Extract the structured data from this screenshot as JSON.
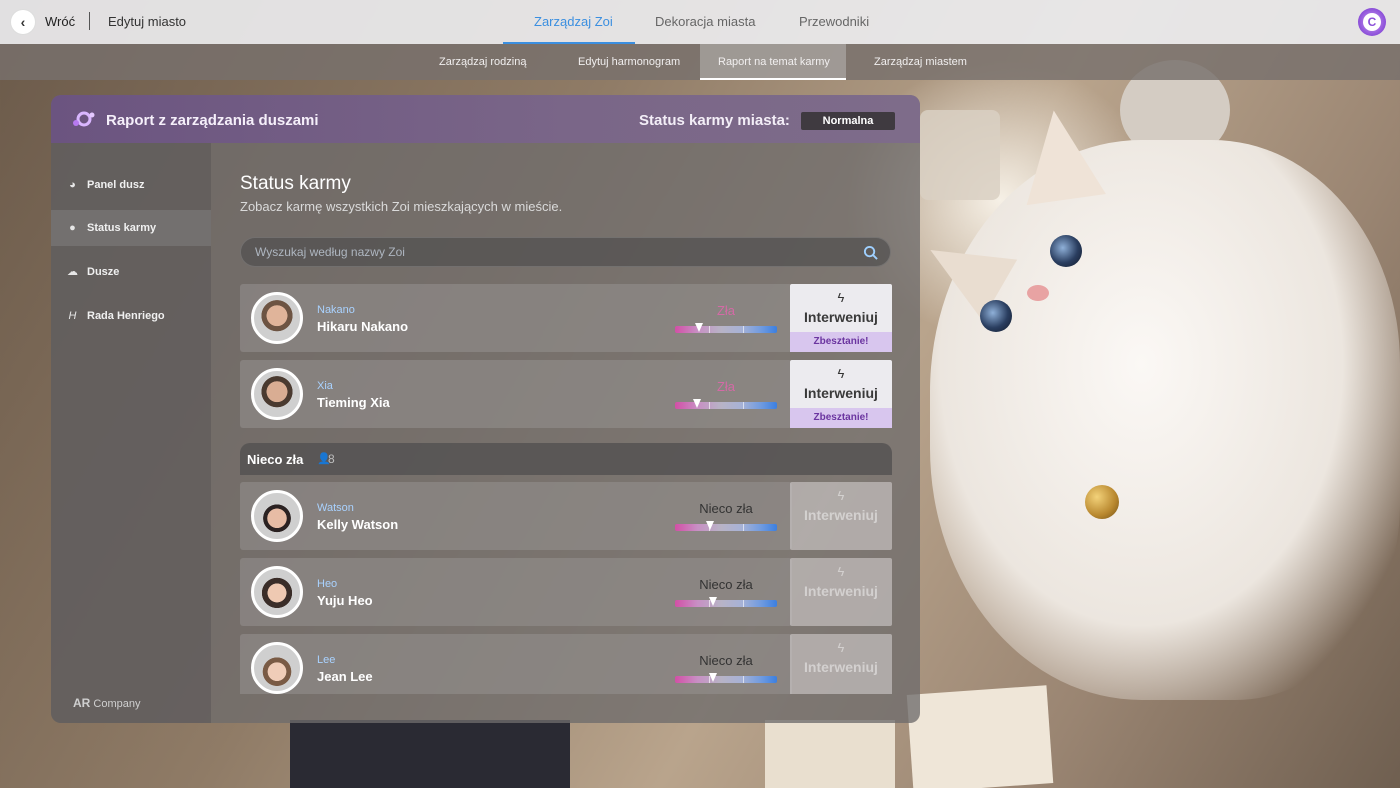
{
  "topbar": {
    "back_label": "Wróć",
    "edit_city": "Edytuj miasto",
    "tabs": [
      {
        "label": "Zarządzaj Zoi",
        "active": true
      },
      {
        "label": "Dekoracja miasta",
        "active": false
      },
      {
        "label": "Przewodniki",
        "active": false
      }
    ],
    "profile_letter": "C"
  },
  "subnav": {
    "tabs": [
      {
        "label": "Zarządzaj rodziną",
        "active": false
      },
      {
        "label": "Edytuj harmonogram",
        "active": false
      },
      {
        "label": "Raport na temat karmy",
        "active": true
      },
      {
        "label": "Zarządzaj miastem",
        "active": false
      }
    ]
  },
  "panel": {
    "title": "Raport z zarządzania duszami",
    "karma_status_label": "Status karmy miasta:",
    "karma_status_value": "Normalna"
  },
  "sidebar": {
    "items": [
      {
        "label": "Panel dusz",
        "icon": "dashboard-icon"
      },
      {
        "label": "Status karmy",
        "icon": "person-icon",
        "active": true
      },
      {
        "label": "Dusze",
        "icon": "ghost-icon"
      },
      {
        "label": "Rada Henriego",
        "icon": "h-icon"
      }
    ],
    "company_logo": "AR",
    "company_text": "Company"
  },
  "content": {
    "title": "Status karmy",
    "subtitle": "Zobacz karmę wszystkich Zoi mieszkających w mieście.",
    "search_placeholder": "Wyszukaj według nazwy Zoi"
  },
  "group": {
    "title": "Nieco zła",
    "count": "8"
  },
  "rows": [
    {
      "surname": "Nakano",
      "fullname": "Hikaru Nakano",
      "karma": "Zła",
      "level": 0.24,
      "action": "Interweniuj",
      "action_sub": "Zbesztanie!",
      "enabled": true
    },
    {
      "surname": "Xia",
      "fullname": "Tieming Xia",
      "karma": "Zła",
      "level": 0.22,
      "action": "Interweniuj",
      "action_sub": "Zbesztanie!",
      "enabled": true
    },
    {
      "surname": "Watson",
      "fullname": "Kelly Watson",
      "karma": "Nieco zła",
      "level": 0.34,
      "action": "Interweniuj",
      "enabled": false
    },
    {
      "surname": "Heo",
      "fullname": "Yuju Heo",
      "karma": "Nieco zła",
      "level": 0.37,
      "action": "Interweniuj",
      "enabled": false
    },
    {
      "surname": "Lee",
      "fullname": "Jean Lee",
      "karma": "Nieco zła",
      "level": 0.37,
      "action": "Interweniuj",
      "enabled": false
    }
  ],
  "colors": {
    "accent_blue": "#3b8fe0",
    "header_purple": "#6b5480",
    "karma_bad": "#d46aa6",
    "reprimand_bg": "#d8c6ee"
  }
}
